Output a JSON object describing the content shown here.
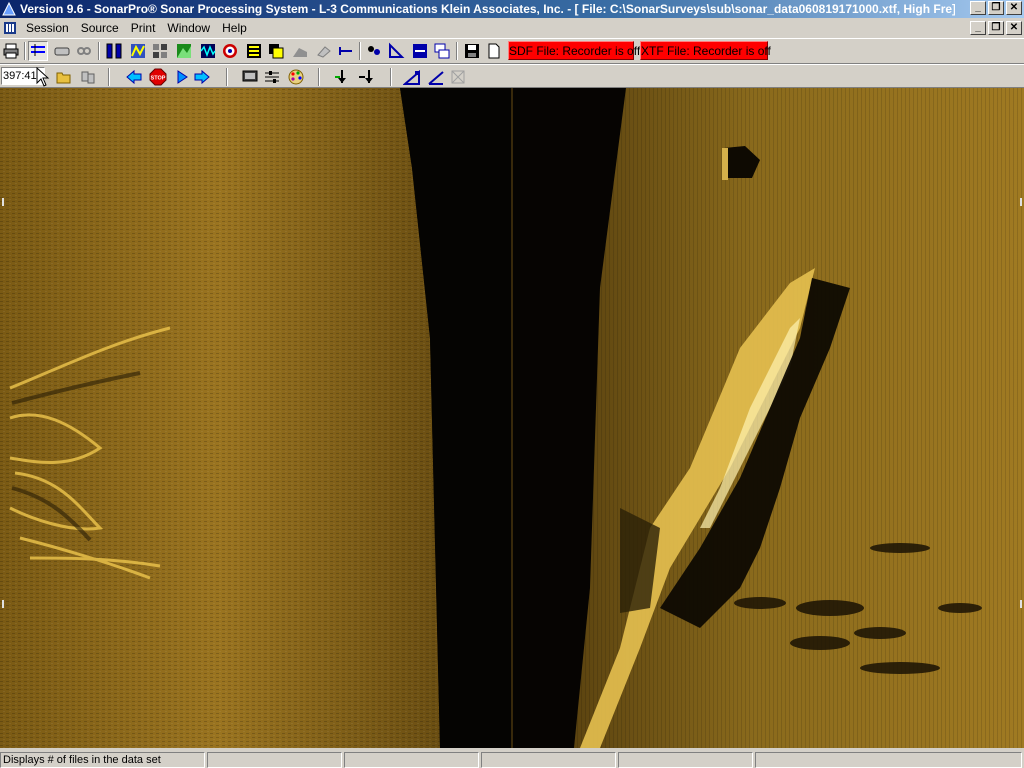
{
  "window": {
    "title": "Version 9.6 - SonarPro® Sonar Processing System - L-3 Communications Klein Associates, Inc. - [ File: C:\\SonarSurveys\\sub\\sonar_data060819171000.xtf, High Fre]"
  },
  "menu": {
    "items": [
      "Session",
      "Source",
      "Print",
      "Window",
      "Help"
    ]
  },
  "toolbar": {
    "sdf_recorder_label": "SDF File: Recorder is off",
    "xtf_recorder_label": "XTF File: Recorder is off",
    "stop_label": "STOP"
  },
  "toolbar2": {
    "coordinate_value": "397:41"
  },
  "colors": {
    "sonar_amber": "#b8891e",
    "recorder_off": "#ff0000",
    "title_blue": "#0a246a"
  },
  "statusbar": {
    "message": "Displays # of files in the data set"
  }
}
